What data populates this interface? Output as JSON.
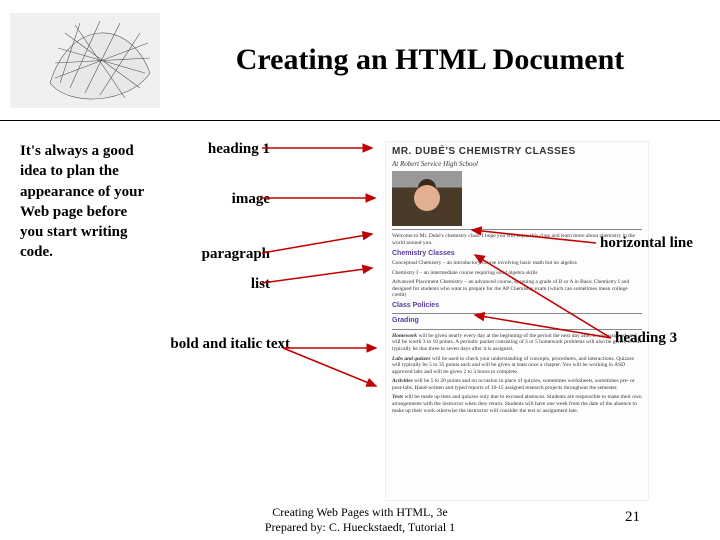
{
  "title": "Creating an HTML Document",
  "left_text": "It's always a good idea to plan the appearance of your Web page before you start writing code.",
  "labels": {
    "heading1": "heading 1",
    "image": "image",
    "paragraph": "paragraph",
    "list": "list",
    "bold_italic": "bold and italic text",
    "hr": "horizontal line",
    "heading3": "heading 3"
  },
  "preview": {
    "h1": "MR. DUBÉ'S CHEMISTRY CLASSES",
    "subtitle": "At Robert Service High School",
    "intro": "Welcome to Mr. Dubé's chemistry class. I hope you will enjoy this class and learn more about chemistry in the world around you.",
    "sec1": "Chemistry Classes",
    "list1": "Conceptual Chemistry – an introductory course involving basic math but no algebra",
    "list2": "Chemistry I – an intermediate course requiring solid algebra skills",
    "list3": "Advanced Placement Chemistry – an advanced course, spanning a grade of B or A in Basic Chemistry I and designed for students who want to prepare for the AP Chemistry exam (which can sometimes mean college credit)",
    "sec2": "Class Policies",
    "sec3": "Grading",
    "p_homework_title": "Homework",
    "p_homework": "will be given nearly every day at the beginning of the period the next day after it was assigned, and will be worth 3 to 10 points. A periodic packet consisting of 3 or 5 homework problems will also be given; it will typically be due three to seven days after it is assigned.",
    "p_lab_title": "Labs and quizzes",
    "p_lab": "will be used to check your understanding of concepts, procedures, and interactions. Quizzes will typically be 5 to 35 points each and will be given at least once a chapter. You will be working in ASD approved labs and will be given 2 to 3 hours to complete.",
    "p_activities_title": "Activities",
    "p_activities": "will be 5 to 20 points and on occasion in place of quizzes, sometimes worksheets, sometimes pre- or post-labs. Hand-written and typed reports of 10-15 assigned research projects throughout the semester.",
    "p_tests_title": "Tests",
    "p_tests": "will be made up tests and quizzes only due to excused absences. Students are responsible to make their own arrangements with the instructor when they return. Students will have one week from the date of the absence to make up their work otherwise the instructor will consider the test or assignment late."
  },
  "footer1": "Creating Web Pages with HTML, 3e",
  "footer2": "Prepared by: C. Hueckstaedt, Tutorial 1",
  "page": "21"
}
